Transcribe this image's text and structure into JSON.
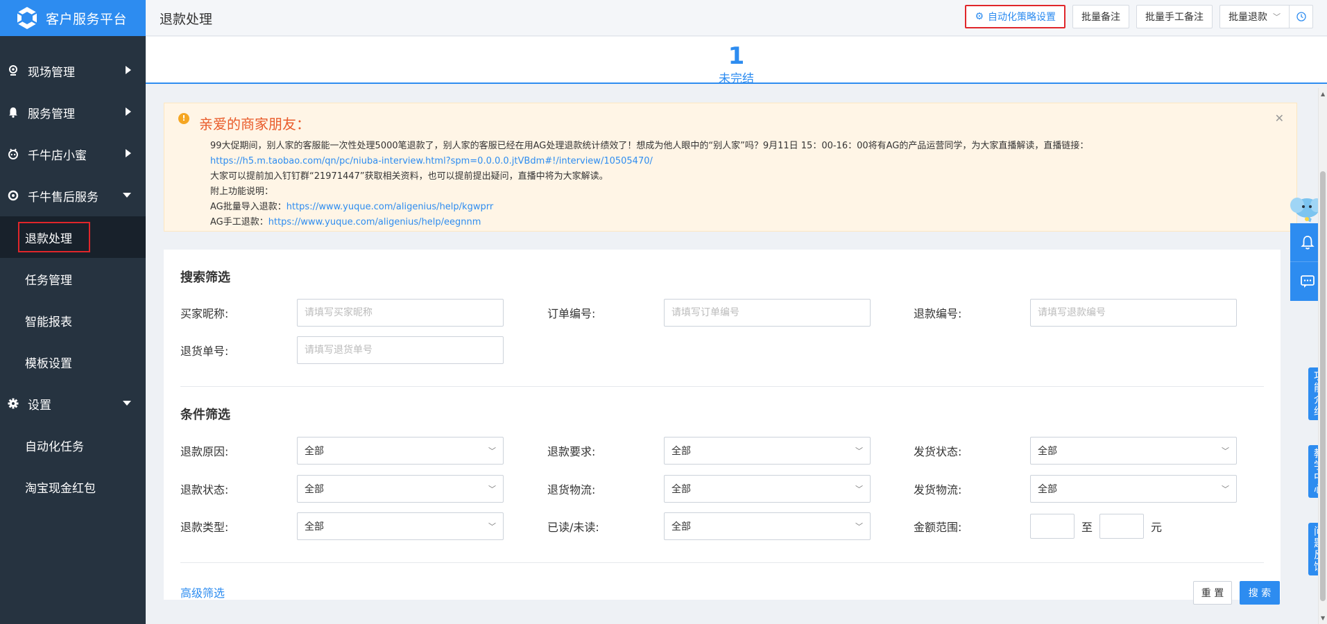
{
  "brand": {
    "title": "客户服务平台",
    "logo_icon": "app-logo-icon"
  },
  "sidebar": {
    "groups": [
      {
        "label": "现场管理",
        "icon": "location-icon",
        "expanded": false
      },
      {
        "label": "服务管理",
        "icon": "bell-icon",
        "expanded": false
      },
      {
        "label": "千牛店小蜜",
        "icon": "robot-icon",
        "expanded": false
      },
      {
        "label": "千牛售后服务",
        "icon": "shield-icon",
        "expanded": true,
        "items": [
          "退款处理",
          "任务管理",
          "智能报表",
          "模板设置"
        ]
      },
      {
        "label": "设置",
        "icon": "gear-icon",
        "expanded": true,
        "items": [
          "自动化任务",
          "淘宝现金红包"
        ]
      }
    ],
    "active_item": "退款处理"
  },
  "header": {
    "title": "退款处理",
    "actions": {
      "auto_strategy": "自动化策略设置",
      "batch_note": "批量备注",
      "batch_manual_note": "批量手工备注",
      "batch_refund": "批量退款"
    }
  },
  "stat": {
    "count": "1",
    "label": "未完结"
  },
  "notice": {
    "heading": "亲爱的商家朋友：",
    "line1": "99大促期间，别人家的客服能一次性处理5000笔退款了，别人家的客服已经在用AG处理退款统计绩效了！想成为他人眼中的“别人家”吗？9月11日 15：00-16：00将有AG的产品运营同学，为大家直播解读，直播链接：",
    "link1": "https://h5.m.taobao.com/qn/pc/niuba-interview.html?spm=0.0.0.0.jtVBdm#!/interview/10505470/",
    "line2": "大家可以提前加入钉钉群“21971447”获取相关资料，也可以提前提出疑问，直播中将为大家解读。",
    "line3": "附上功能说明：",
    "line4_prefix": "AG批量导入退款：",
    "link4": "https://www.yuque.com/aligenius/help/kgwprr",
    "line5_prefix": "AG手工退款：",
    "link5": "https://www.yuque.com/aligenius/help/eegnnm"
  },
  "search": {
    "title": "搜索筛选",
    "buyer_label": "买家昵称:",
    "buyer_placeholder": "请填写买家昵称",
    "order_label": "订单编号:",
    "order_placeholder": "请填写订单编号",
    "refund_label": "退款编号:",
    "refund_placeholder": "请填写退款编号",
    "return_label": "退货单号:",
    "return_placeholder": "请填写退货单号"
  },
  "conditions": {
    "title": "条件筛选",
    "refund_reason": {
      "label": "退款原因:",
      "value": "全部"
    },
    "refund_request": {
      "label": "退款要求:",
      "value": "全部"
    },
    "ship_status": {
      "label": "发货状态:",
      "value": "全部"
    },
    "refund_status": {
      "label": "退款状态:",
      "value": "全部"
    },
    "return_logistics": {
      "label": "退货物流:",
      "value": "全部"
    },
    "ship_logistics": {
      "label": "发货物流:",
      "value": "全部"
    },
    "refund_type": {
      "label": "退款类型:",
      "value": "全部"
    },
    "read_status": {
      "label": "已读/未读:",
      "value": "全部"
    },
    "amount": {
      "label": "金额范围:",
      "sep": "至",
      "unit": "元"
    }
  },
  "footer": {
    "advanced": "高级筛选",
    "reset": "重 置",
    "search": "搜 索"
  },
  "side_tabs": {
    "intro": "功能介绍",
    "teach": "教学中心",
    "feedback": "问题反馈"
  },
  "colors": {
    "primary": "#2d8cf0",
    "sidebar": "#263340",
    "highlight": "#e0262a",
    "notice_bg": "#fff5e6",
    "notice_title": "#e95b2a"
  }
}
